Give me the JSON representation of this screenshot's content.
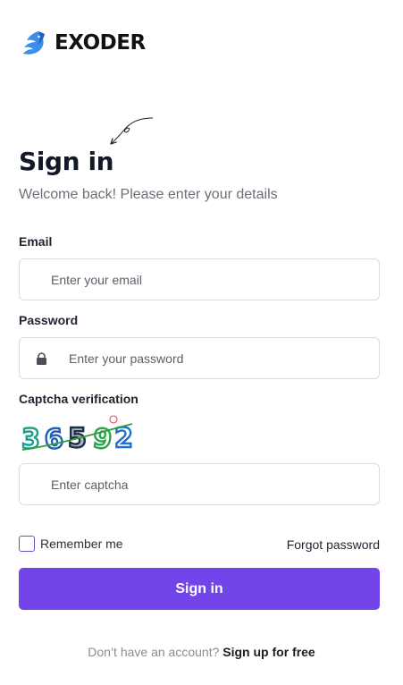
{
  "brand": {
    "name": "EXODER",
    "icon": "bird-logo-icon"
  },
  "form": {
    "title": "Sign in",
    "subtitle": "Welcome back! Please enter your details",
    "email": {
      "label": "Email",
      "placeholder": "Enter your email",
      "value": ""
    },
    "password": {
      "label": "Password",
      "placeholder": "Enter your password",
      "value": "",
      "icon": "lock-icon"
    },
    "captcha": {
      "label": "Captcha verification",
      "code": "36592",
      "placeholder": "Enter captcha",
      "value": ""
    },
    "remember_label": "Remember me",
    "remember_checked": false,
    "forgot_label": "Forgot password",
    "submit_label": "Sign in"
  },
  "footer": {
    "text": "Don’t have an account?",
    "link_label": "Sign up for free"
  },
  "colors": {
    "accent": "#7245ea",
    "logo_blue": "#3b8fe8",
    "text_primary": "#111827",
    "text_muted": "#6b6f7a",
    "border": "#d9dbe0"
  }
}
